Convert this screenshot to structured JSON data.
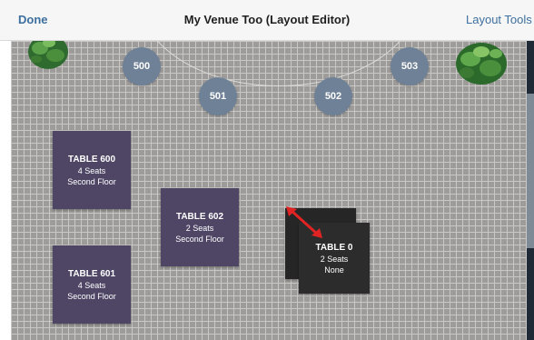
{
  "navbar": {
    "done_label": "Done",
    "title": "My Venue Too (Layout Editor)",
    "tools_label": "Layout Tools"
  },
  "seats": [
    {
      "label": "500"
    },
    {
      "label": "501"
    },
    {
      "label": "502"
    },
    {
      "label": "503"
    }
  ],
  "tables": [
    {
      "name": "TABLE 600",
      "seats": "4 Seats",
      "area": "Second Floor"
    },
    {
      "name": "TABLE 602",
      "seats": "2 Seats",
      "area": "Second Floor"
    },
    {
      "name": "TABLE 601",
      "seats": "4 Seats",
      "area": "Second Floor"
    },
    {
      "name": "TABLE 0",
      "seats": "2 Seats",
      "area": "None"
    }
  ],
  "colors": {
    "accent": "#3d6f9e",
    "table_purple": "#4f4666",
    "table_selected": "#2c2c2c",
    "seat_blue": "#6f8196",
    "resize_arrow": "#e02424"
  },
  "icons": {
    "resize_handle": "resize-arrow-icon",
    "decor": "plant-icon"
  }
}
